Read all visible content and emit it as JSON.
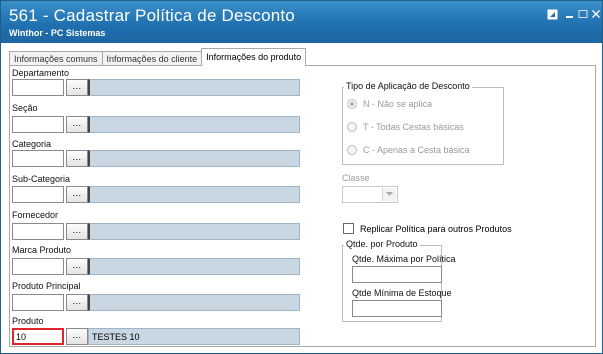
{
  "window": {
    "title": "561 - Cadastrar Política de Desconto",
    "subtitle": "Winthor - PC Sistemas",
    "controls": [
      "restore-icon",
      "minimize-icon",
      "maximize-icon",
      "close-icon"
    ]
  },
  "tabs": [
    {
      "label": "Informações comuns",
      "active": false
    },
    {
      "label": "Informações do cliente",
      "active": false
    },
    {
      "label": "Informações do produto",
      "active": true
    }
  ],
  "fields": {
    "departamento": {
      "label": "Departamento",
      "code": "",
      "description": ""
    },
    "secao": {
      "label": "Seção",
      "code": "",
      "description": ""
    },
    "categoria": {
      "label": "Categoria",
      "code": "",
      "description": ""
    },
    "subcategoria": {
      "label": "Sub-Categoria",
      "code": "",
      "description": ""
    },
    "fornecedor": {
      "label": "Fornecedor",
      "code": "",
      "description": ""
    },
    "marca": {
      "label": "Marca Produto",
      "code": "",
      "description": ""
    },
    "produto_principal": {
      "label": "Produto Principal",
      "code": "",
      "description": ""
    },
    "produto": {
      "label": "Produto",
      "code": "10",
      "description": "TESTES 10"
    }
  },
  "lookup_button_label": "...",
  "tipo_aplicacao": {
    "legend": "Tipo de Aplicação de Desconto",
    "options": [
      {
        "label": "N - Não se aplica",
        "checked": true
      },
      {
        "label": "T - Todas Cestas básicas",
        "checked": false
      },
      {
        "label": "C - Apenas a Cesta básica",
        "checked": false
      }
    ],
    "enabled": false
  },
  "classe": {
    "label": "Classe",
    "value": ""
  },
  "replicar": {
    "label": "Replicar Política para outros Produtos",
    "checked": false
  },
  "qtde_produto": {
    "legend": "Qtde. por Produto",
    "max_label": "Qtde. Máxima por Política",
    "max_value": "",
    "min_label": "Qtde Mínima de Estoque",
    "min_value": ""
  },
  "colors": {
    "title_bar": "#1f6fae",
    "focus_border": "#e0262b",
    "description_bg": "#c9d7e3"
  }
}
